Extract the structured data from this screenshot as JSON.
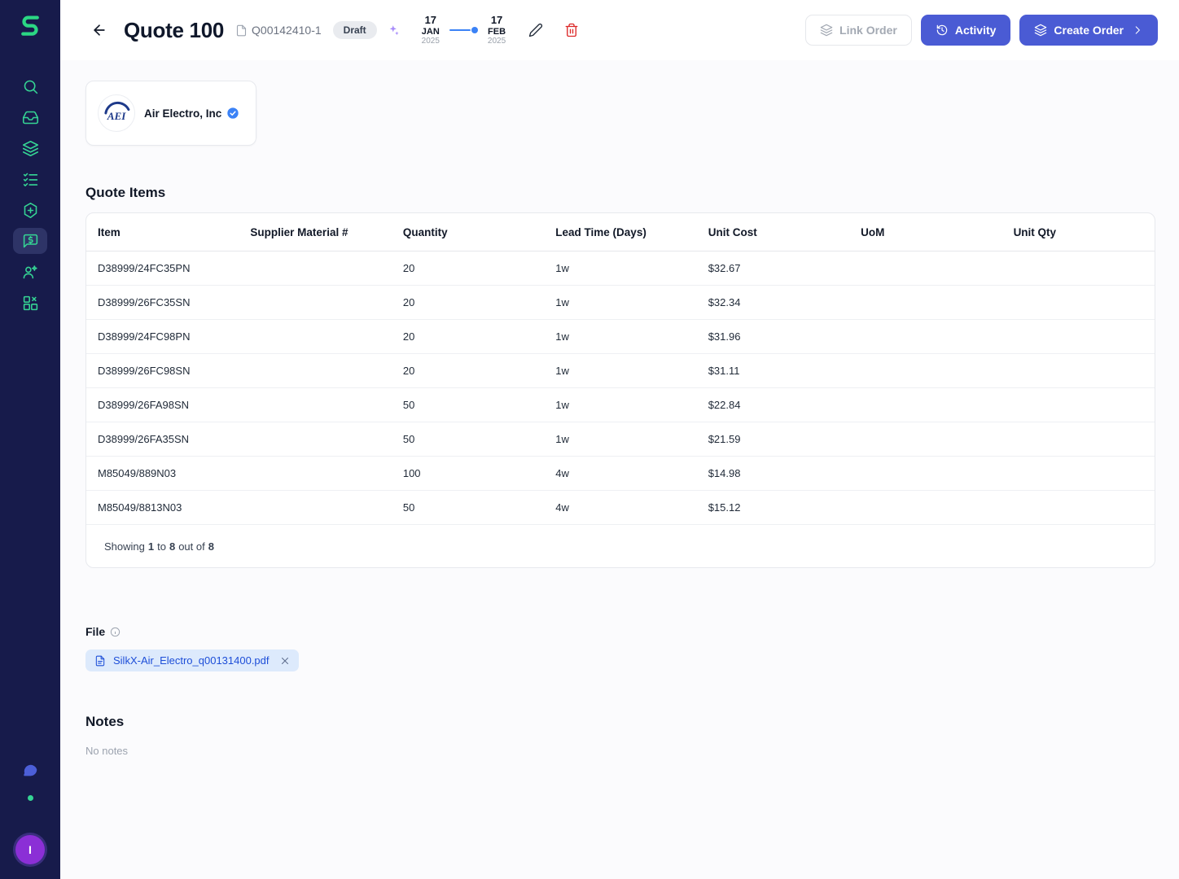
{
  "user": {
    "avatar_initial": "I"
  },
  "header": {
    "title": "Quote 100",
    "quote_number": "Q00142410-1",
    "status_badge": "Draft",
    "dates": {
      "start": {
        "day": "17",
        "month": "JAN",
        "year": "2025"
      },
      "end": {
        "day": "17",
        "month": "FEB",
        "year": "2025"
      }
    },
    "actions": {
      "link_order": "Link Order",
      "activity": "Activity",
      "create_order": "Create Order"
    }
  },
  "supplier": {
    "name": "Air Electro, Inc",
    "logo_text": "AEI",
    "verified": true
  },
  "quote_items": {
    "title": "Quote Items",
    "columns": [
      "Item",
      "Supplier Material #",
      "Quantity",
      "Lead Time (Days)",
      "Unit Cost",
      "UoM",
      "Unit Qty"
    ],
    "rows": [
      {
        "item": "D38999/24FC35PN",
        "supplier_material": "",
        "quantity": "20",
        "lead_time": "1w",
        "unit_cost": "$32.67",
        "uom": "",
        "unit_qty": ""
      },
      {
        "item": "D38999/26FC35SN",
        "supplier_material": "",
        "quantity": "20",
        "lead_time": "1w",
        "unit_cost": "$32.34",
        "uom": "",
        "unit_qty": ""
      },
      {
        "item": "D38999/24FC98PN",
        "supplier_material": "",
        "quantity": "20",
        "lead_time": "1w",
        "unit_cost": "$31.96",
        "uom": "",
        "unit_qty": ""
      },
      {
        "item": "D38999/26FC98SN",
        "supplier_material": "",
        "quantity": "20",
        "lead_time": "1w",
        "unit_cost": "$31.11",
        "uom": "",
        "unit_qty": ""
      },
      {
        "item": "D38999/26FA98SN",
        "supplier_material": "",
        "quantity": "50",
        "lead_time": "1w",
        "unit_cost": "$22.84",
        "uom": "",
        "unit_qty": ""
      },
      {
        "item": "D38999/26FA35SN",
        "supplier_material": "",
        "quantity": "50",
        "lead_time": "1w",
        "unit_cost": "$21.59",
        "uom": "",
        "unit_qty": ""
      },
      {
        "item": "M85049/889N03",
        "supplier_material": "",
        "quantity": "100",
        "lead_time": "4w",
        "unit_cost": "$14.98",
        "uom": "",
        "unit_qty": ""
      },
      {
        "item": "M85049/8813N03",
        "supplier_material": "",
        "quantity": "50",
        "lead_time": "4w",
        "unit_cost": "$15.12",
        "uom": "",
        "unit_qty": ""
      }
    ],
    "pagination": {
      "prefix": "Showing",
      "from": "1",
      "to_word": "to",
      "to": "8",
      "outof_word": "out of",
      "total": "8"
    }
  },
  "file_section": {
    "label": "File",
    "file_name": "SilkX-Air_Electro_q00131400.pdf"
  },
  "notes_section": {
    "label": "Notes",
    "empty_text": "No notes"
  },
  "colors": {
    "sidebar_bg": "#171b4b",
    "accent_green": "#35d494",
    "primary_indigo": "#4a5bd4",
    "danger_red": "#dc2626",
    "date_accent_blue": "#3b82f6",
    "file_chip_bg": "#ddeafc",
    "file_chip_text": "#1d4ed8",
    "avatar_purple": "#8b2fd6"
  }
}
